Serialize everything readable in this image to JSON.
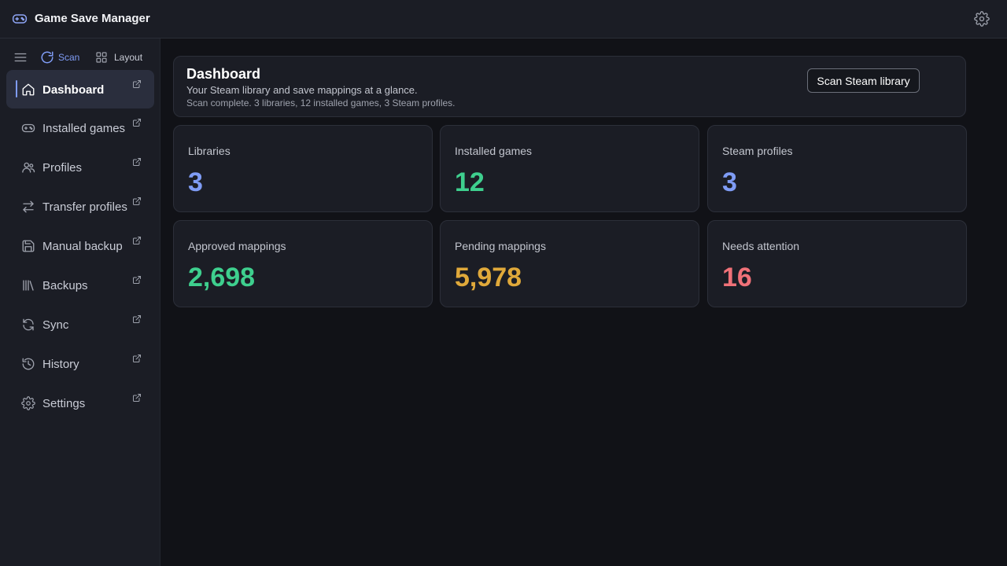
{
  "app": {
    "title": "Game Save Manager",
    "icon": "gamepad-icon"
  },
  "toolbar": {
    "scan_label": "Scan",
    "layout_label": "Layout"
  },
  "sidebar": {
    "items": [
      {
        "label": "Dashboard",
        "icon": "home-icon",
        "active": true
      },
      {
        "label": "Installed games",
        "icon": "gamepad-icon"
      },
      {
        "label": "Profiles",
        "icon": "users-icon"
      },
      {
        "label": "Transfer profiles",
        "icon": "arrows-swap-icon"
      },
      {
        "label": "Manual backup",
        "icon": "save-icon"
      },
      {
        "label": "Backups",
        "icon": "library-icon"
      },
      {
        "label": "Sync",
        "icon": "refresh-icon"
      },
      {
        "label": "History",
        "icon": "history-icon"
      },
      {
        "label": "Settings",
        "icon": "gear-icon"
      }
    ]
  },
  "dashboard": {
    "title": "Dashboard",
    "subtitle": "Your Steam library and save mappings at a glance.",
    "status": "Scan complete. 3 libraries, 12 installed games, 3 Steam profiles.",
    "scan_button": "Scan Steam library"
  },
  "stats": [
    {
      "label": "Libraries",
      "value": "3",
      "color": "#7f9cf5"
    },
    {
      "label": "Installed games",
      "value": "12",
      "color": "#3ecf8e"
    },
    {
      "label": "Steam profiles",
      "value": "3",
      "color": "#7f9cf5"
    },
    {
      "label": "Approved mappings",
      "value": "2,698",
      "color": "#3ecf8e"
    },
    {
      "label": "Pending mappings",
      "value": "5,978",
      "color": "#e0a93a"
    },
    {
      "label": "Needs attention",
      "value": "16",
      "color": "#f07178"
    }
  ],
  "colors": {
    "accent": "#7f9cf5"
  }
}
